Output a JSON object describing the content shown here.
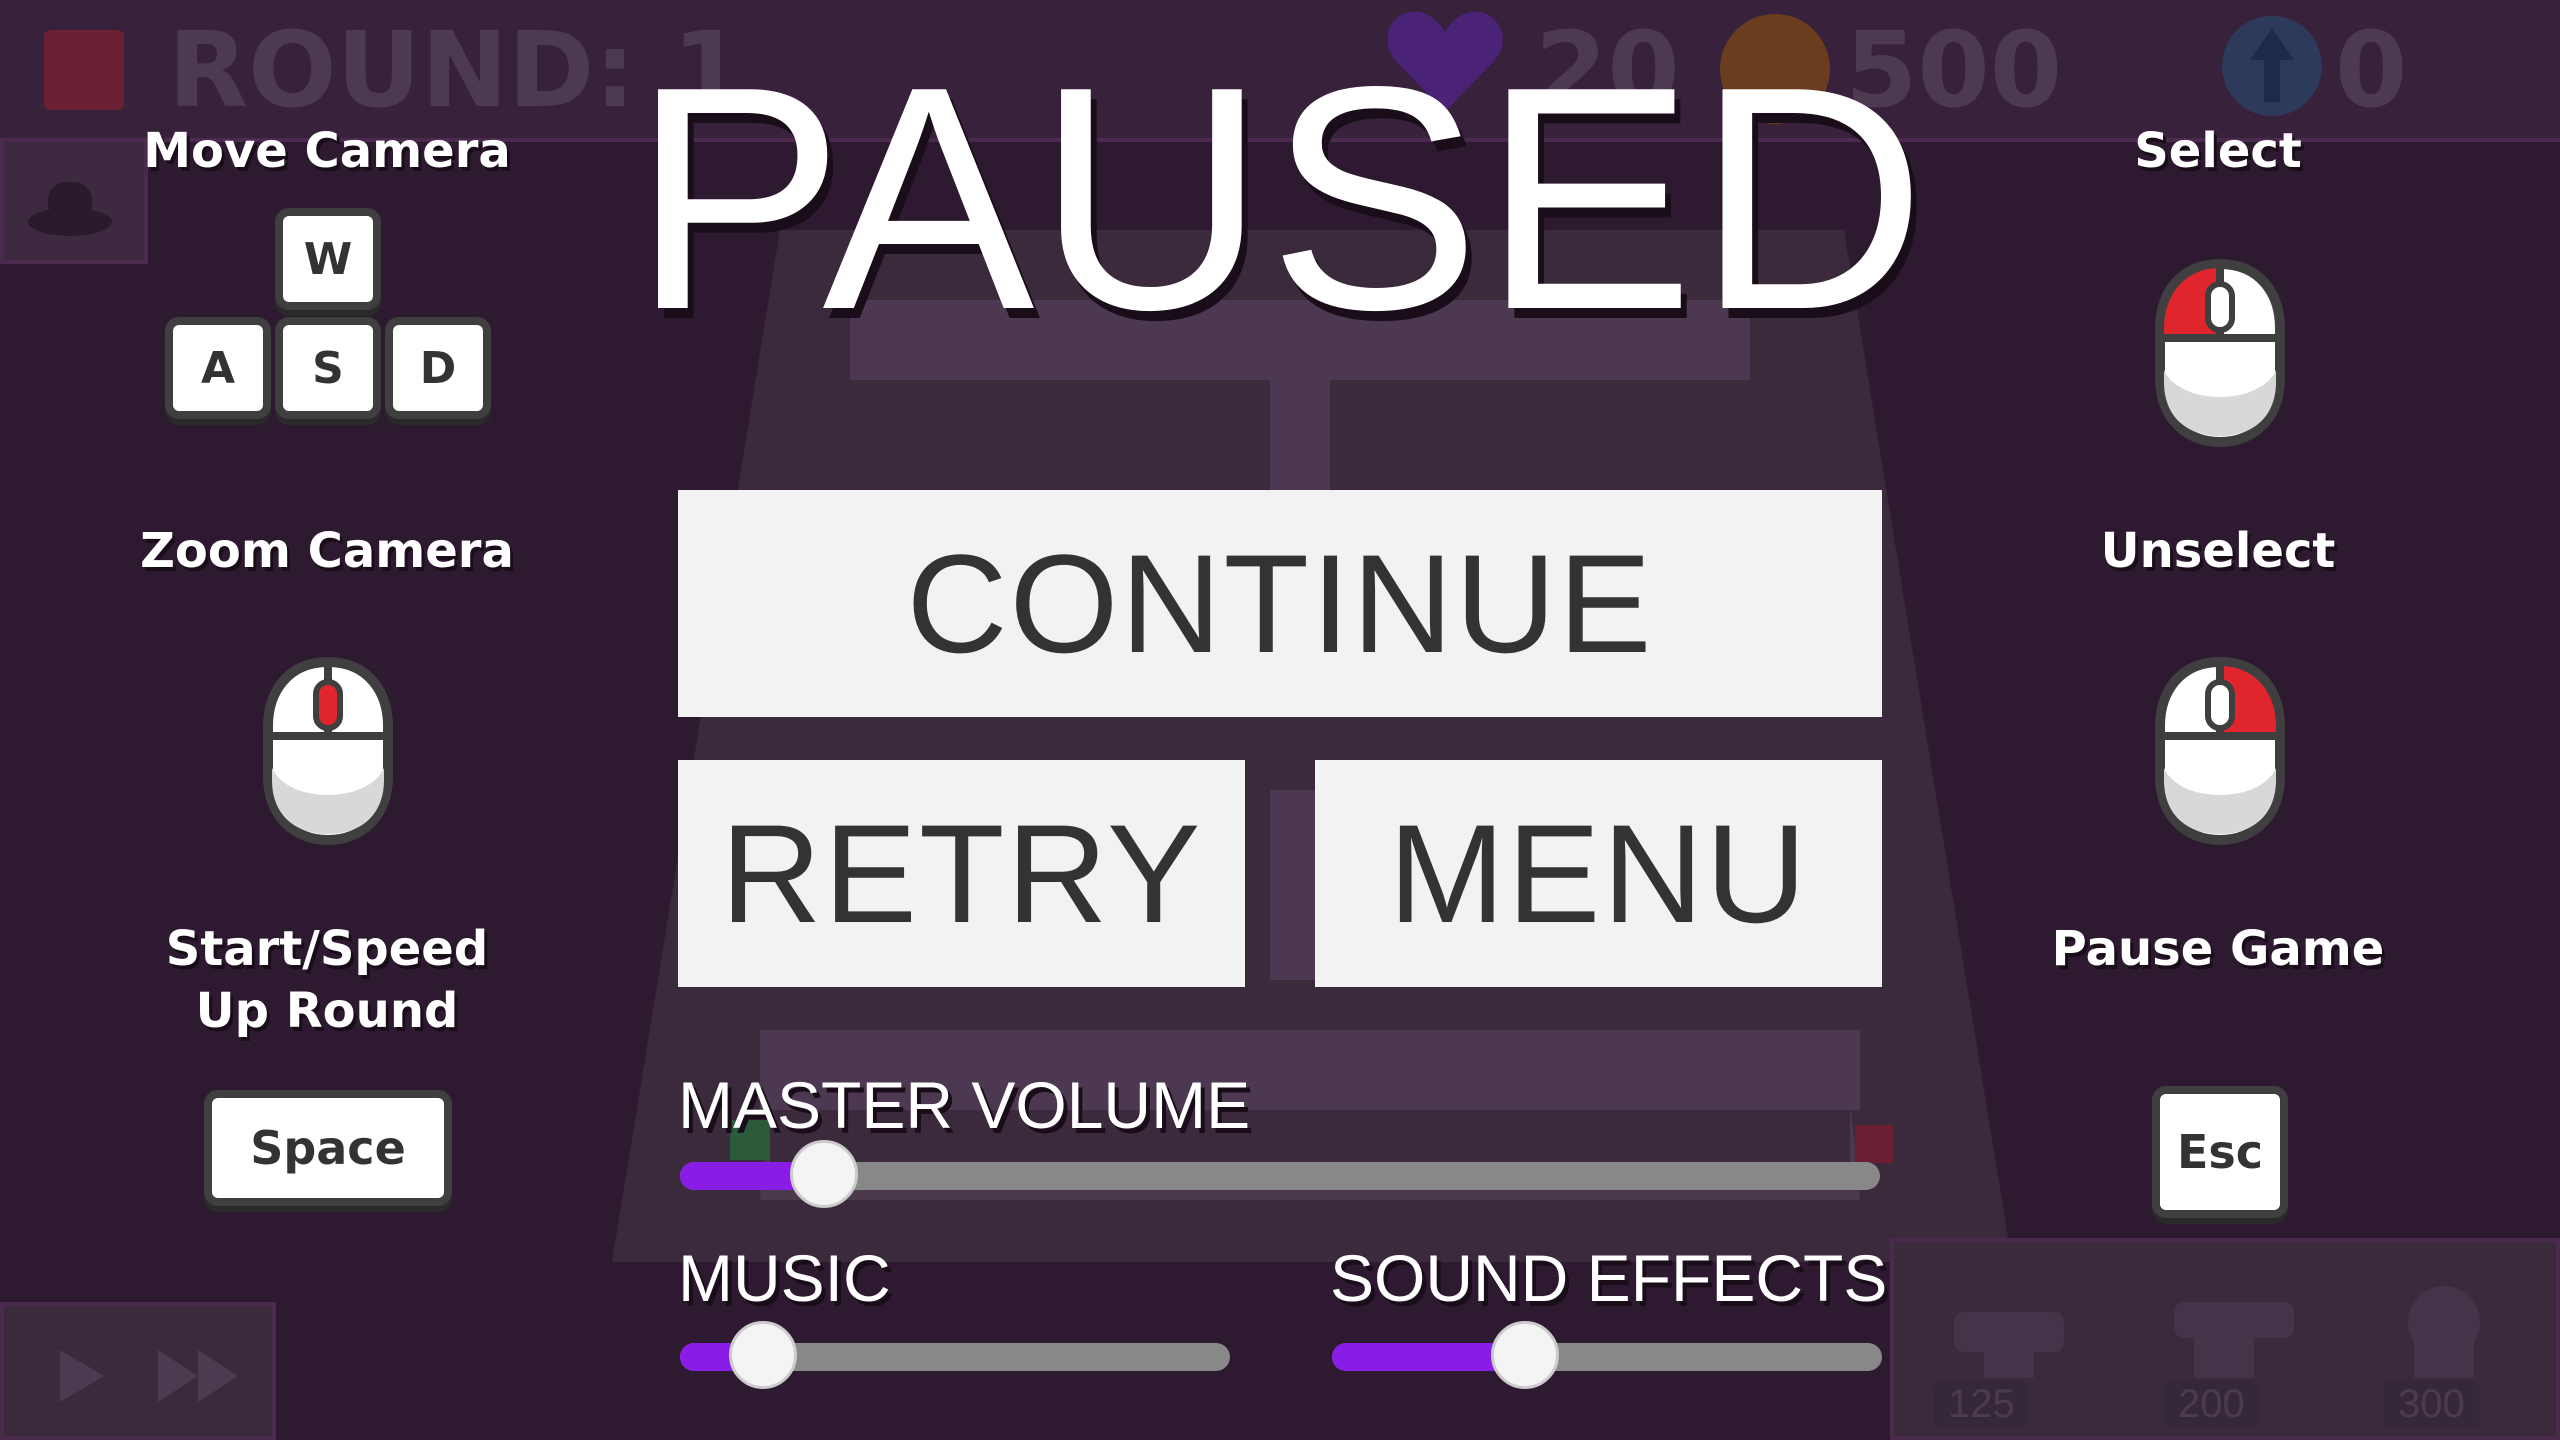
{
  "hud": {
    "round_label": "ROUND: 1",
    "lives": "20",
    "money": "500",
    "upgrades": "0"
  },
  "pause_menu": {
    "title": "PAUSED",
    "continue_label": "CONTINUE",
    "retry_label": "RETRY",
    "menu_label": "MENU"
  },
  "audio": {
    "master_label": "MASTER VOLUME",
    "master_value": 0.12,
    "music_label": "MUSIC",
    "music_value": 0.15,
    "sfx_label": "SOUND EFFECTS",
    "sfx_value": 0.35
  },
  "controls": {
    "move_camera": {
      "label": "Move Camera",
      "keys": [
        "W",
        "A",
        "S",
        "D"
      ]
    },
    "zoom_camera": {
      "label": "Zoom Camera",
      "icon": "mouse-wheel-icon"
    },
    "start_round": {
      "label_line1": "Start/Speed",
      "label_line2": "Up Round",
      "key": "Space"
    },
    "select": {
      "label": "Select",
      "icon": "mouse-left-click-icon"
    },
    "unselect": {
      "label": "Unselect",
      "icon": "mouse-right-click-icon"
    },
    "pause_game": {
      "label": "Pause Game",
      "key": "Esc"
    }
  },
  "towers": [
    {
      "price": "125"
    },
    {
      "price": "200"
    },
    {
      "price": "300"
    }
  ],
  "colors": {
    "background": "#2e1a30",
    "button_bg": "#f2f2f2",
    "button_text": "#333333",
    "slider_fill": "#8a1ce8",
    "slider_track": "#888888",
    "mouse_highlight": "#e0262c"
  }
}
